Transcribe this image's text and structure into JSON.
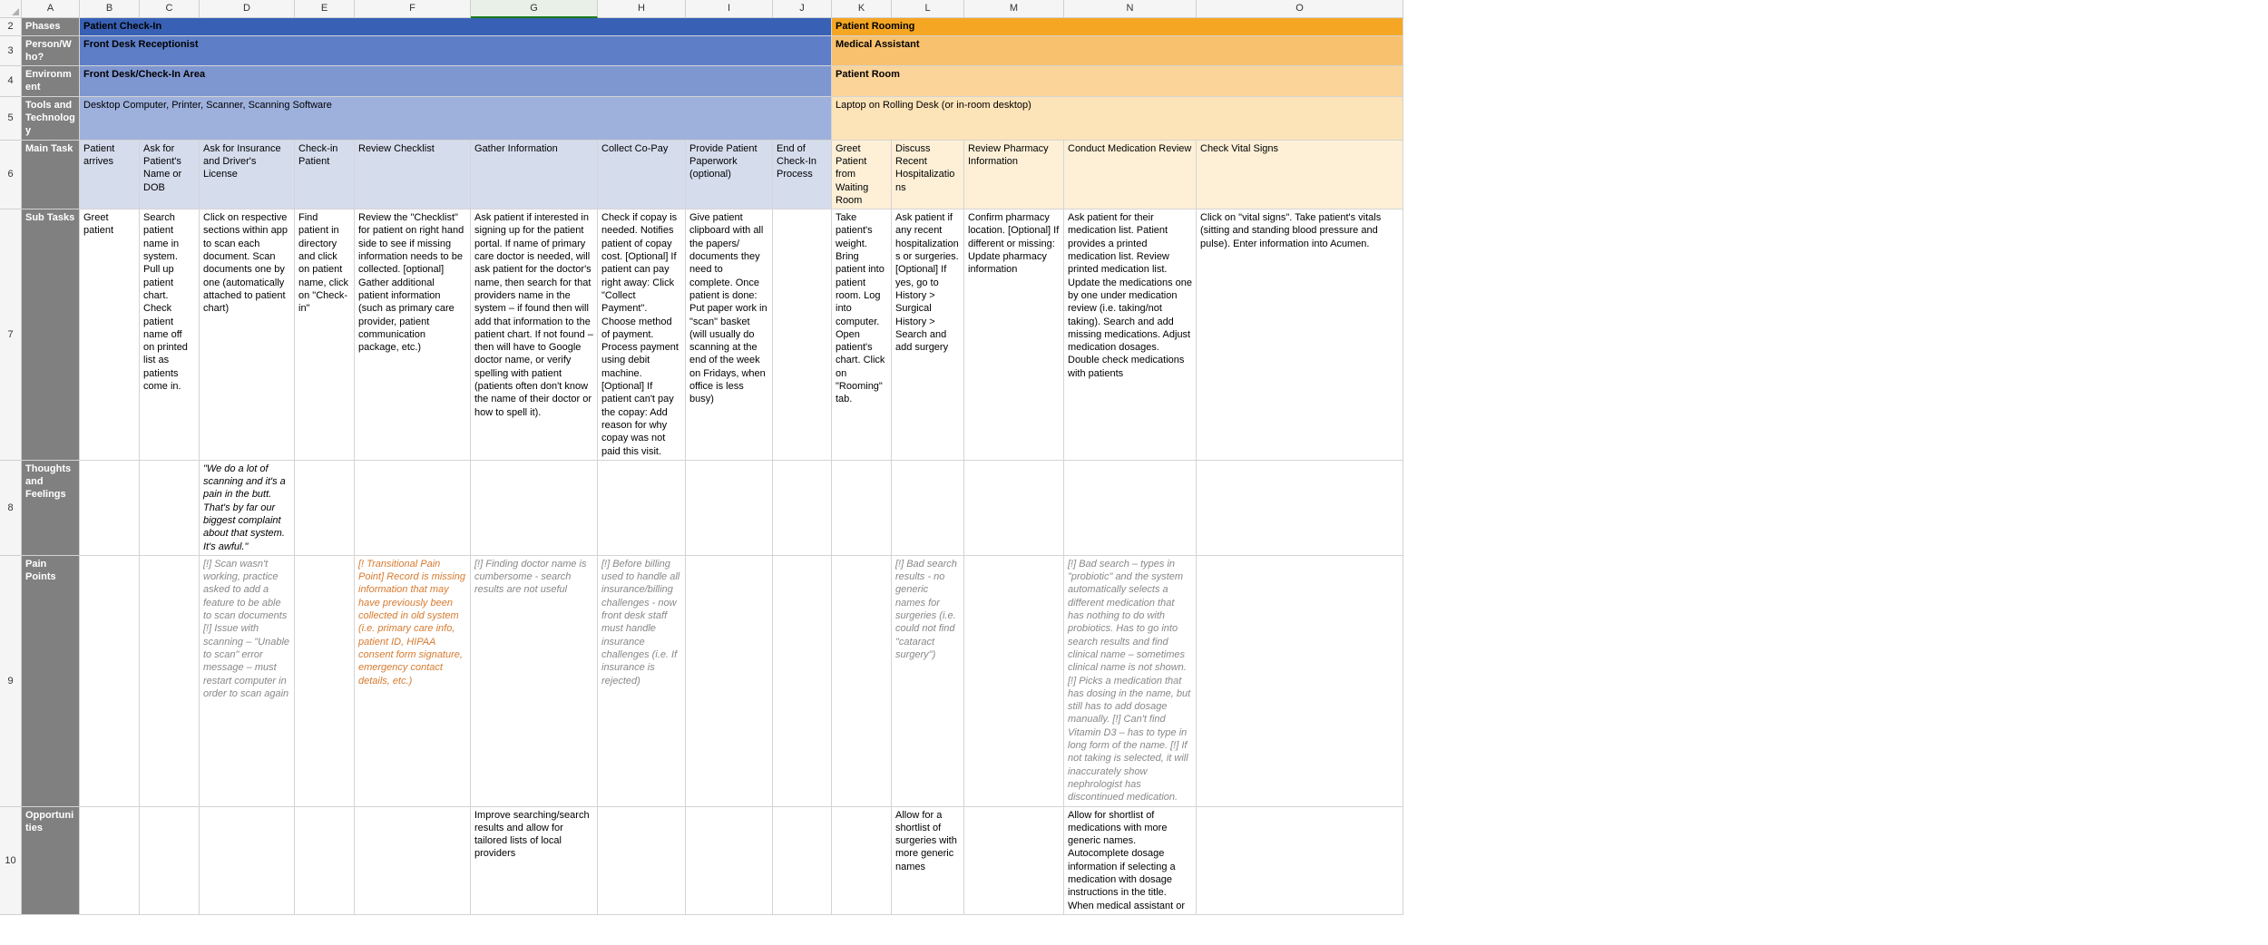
{
  "columns": [
    "",
    "A",
    "B",
    "C",
    "D",
    "E",
    "F",
    "G",
    "H",
    "I",
    "J",
    "K",
    "L",
    "M",
    "N",
    "O"
  ],
  "selected_column_index": 7,
  "rows": [
    "2",
    "3",
    "4",
    "5",
    "6",
    "7",
    "8",
    "9",
    "10"
  ],
  "side": {
    "r2": "Phases",
    "r3": "Person/Who?",
    "r4": "Environment",
    "r5": "Tools and Technology",
    "r6": "Main Task",
    "r7": "Sub Tasks",
    "r8": "Thoughts and Feelings",
    "r9": "Pain Points",
    "r10": "Opportunities"
  },
  "phase": {
    "checkin": "Patient Check-In",
    "rooming": "Patient Rooming"
  },
  "person": {
    "checkin": "Front Desk Receptionist",
    "rooming": "Medical Assistant"
  },
  "env": {
    "checkin": "Front Desk/Check-In Area",
    "rooming": "Patient Room"
  },
  "tools": {
    "checkin": "Desktop Computer, Printer, Scanner, Scanning Software",
    "rooming": " Laptop on Rolling Desk (or in-room desktop)"
  },
  "maintask": {
    "B": "Patient arrives",
    "C": "Ask for Patient's Name or DOB",
    "D": "Ask for Insurance and Driver's License",
    "E": "Check-in Patient",
    "F": "Review Checklist",
    "G": "Gather Information",
    "H": "Collect Co-Pay",
    "I": "Provide Patient Paperwork (optional)",
    "J": "End of Check-In Process",
    "K": "Greet Patient from Waiting Room",
    "L": "Discuss Recent Hospitalizations",
    "M": "Review Pharmacy Information",
    "N": "Conduct Medication Review",
    "O": "Check Vital Signs"
  },
  "subtask": {
    "B": "Greet patient",
    "C": "Search patient name in system. Pull up patient chart. Check patient name off on  printed list as patients come in.",
    "D": "Click on respective sections within app to scan each document.  Scan documents one by one (automatically attached to patient chart)",
    "E": "Find patient in directory and click on patient name, click on \"Check-in\"",
    "F": "Review the \"Checklist\" for patient on right hand side to see if missing information needs to be collected. [optional] Gather additional patient  information (such as primary care provider, patient communication package, etc.)",
    "G": "Ask patient if  interested in signing up for the patient portal. If name of primary care doctor is needed, will ask patient for the doctor's name, then search for that providers name in the system – if found then will add that information to the patient chart. If not found – then will have to Google doctor name, or verify spelling with patient (patients often don't know the name of their doctor or how to spell it).",
    "H": "Check if copay is needed. Notifies patient of copay cost. [Optional] If patient can pay right away: Click \"Collect Payment\". Choose method of payment. Process payment using debit machine. [Optional] If patient can't pay the copay: Add reason for why copay was not paid this visit.",
    "I": "Give patient clipboard with all the papers/ documents they need to complete. Once patient is done: Put paper work in \"scan\" basket (will usually do scanning at the end of the week on Fridays, when office is less busy)",
    "J": "",
    "K": "Take patient's weight. Bring patient into patient room. Log into computer. Open patient's chart. Click on \"Rooming\" tab.",
    "L": "Ask patient if any recent hospitalizations or surgeries. [Optional] If yes, go to History > Surgical History > Search and add surgery",
    "M": "Confirm pharmacy location. [Optional] If different or missing: Update pharmacy information",
    "N": "Ask patient for their medication list. Patient provides a printed medication list. Review printed medication list. Update the medications one by one under medication review (i.e. taking/not taking). Search and add missing medications. Adjust medication dosages. Double check medications with patients",
    "O": "Click on \"vital signs\". Take patient's vitals (sitting and standing blood pressure and pulse). Enter information into Acumen."
  },
  "thoughts": {
    "D": "\"We do a lot of scanning and it's a pain in the butt. That's by far our biggest complaint about that system. It's awful.\""
  },
  "painpoints": {
    "D": "[!] Scan wasn't working, practice asked to add a feature to be able to scan documents   [!] Issue with scanning –  \"Unable to scan\" error message – must restart computer in order to scan again",
    "F": "[! Transitional Pain Point] Record is missing information that may have previously been collected in old system (i.e. primary care info, patient ID, HIPAA consent form signature, emergency contact details, etc.)",
    "G": "[!] Finding doctor name is cumbersome - search results are not useful",
    "H": "[!] Before billing used to handle all insurance/billing challenges - now front desk staff must handle insurance challenges (i.e. If insurance is rejected)",
    "L": "[!] Bad search results - no generic names for surgeries (i.e. could not find \"cataract surgery\")",
    "N": "[!] Bad search – types in \"probiotic\" and the system automatically selects a different medication that has nothing to do with probiotics. Has to go into search results and find clinical name – sometimes clinical name is not shown. [!] Picks a medication that has dosing in the name, but still has to add dosage manually. [!] Can't find Vitamin D3 – has to type in long form of the name. [!] If not taking is selected, it will inaccurately show nephrologist has discontinued medication."
  },
  "opportunities": {
    "G": "Improve searching/search results and allow for tailored lists of local providers",
    "L": "Allow for a shortlist of surgeries with more generic names",
    "N": "Allow for shortlist of medications with more generic names. Autocomplete dosage information if selecting a medication with dosage instructions in the title. When medical assistant or"
  }
}
